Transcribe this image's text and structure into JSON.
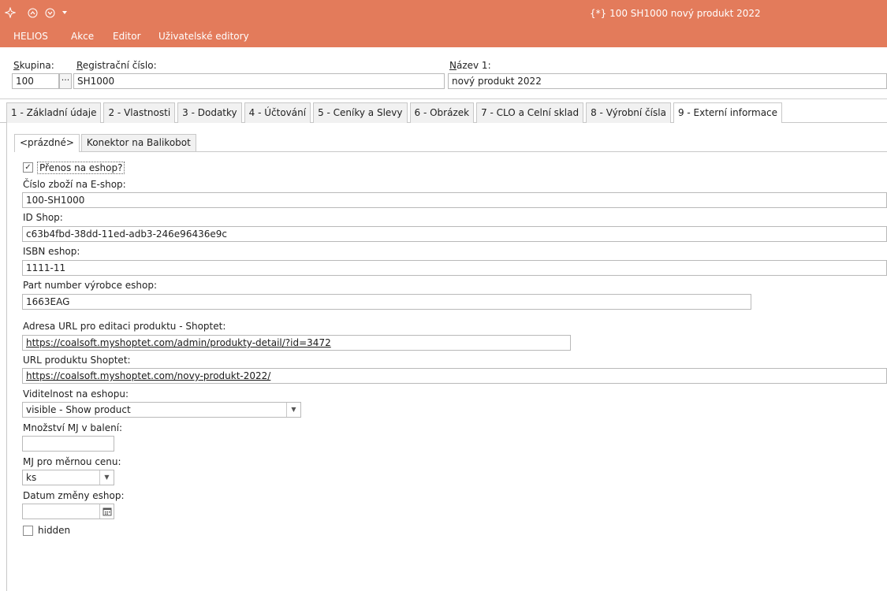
{
  "window": {
    "title": "{*} 100 SH1000 nový produkt 2022",
    "quick_icons": [
      "sparkle-icon",
      "up-circle-icon",
      "down-circle-icon",
      "dropdown-arrow-icon"
    ]
  },
  "menu": {
    "items": [
      "HELIOS",
      "Akce",
      "Editor",
      "Uživatelské editory"
    ]
  },
  "header": {
    "skupina_label": "Skupina:",
    "skupina_value": "100",
    "dots_label": "···",
    "reg_label": "Registrační číslo:",
    "reg_value": "SH1000",
    "nazev_label": "Název 1:",
    "nazev_value": "nový produkt 2022"
  },
  "tabs": [
    "1 - Základní údaje",
    "2 - Vlastnosti",
    "3 - Dodatky",
    "4 - Účtování",
    "5 - Ceníky a Slevy",
    "6 - Obrázek",
    "7 - CLO a Celní sklad",
    "8 - Výrobní čísla",
    "9 - Externí informace"
  ],
  "active_tab": "9 - Externí informace",
  "subtabs": [
    "<prázdné>",
    "Konektor na Balikobot"
  ],
  "form": {
    "prenos_label": "Přenos na eshop?",
    "prenos_checked": true,
    "cislo_label": "Číslo zboží na E-shop:",
    "cislo_value": "100-SH1000",
    "idshop_label": "ID Shop:",
    "idshop_value": "c63b4fbd-38dd-11ed-adb3-246e96436e9c",
    "isbn_label": "ISBN eshop:",
    "isbn_value": "1111-11",
    "part_label": "Part number výrobce eshop:",
    "part_value": "1663EAG",
    "adresa_label": "Adresa URL pro editaci produktu - Shoptet:",
    "adresa_value": "https://coalsoft.myshoptet.com/admin/produkty-detail/?id=3472",
    "url_label": "URL produktu Shoptet:",
    "url_value": "https://coalsoft.myshoptet.com/novy-produkt-2022/",
    "viditelnost_label": "Viditelnost na eshopu:",
    "viditelnost_value": "visible - Show product",
    "mnozstvi_label": "Množství MJ v balení:",
    "mnozstvi_value": "",
    "mj_label": "MJ pro měrnou cenu:",
    "mj_value": "ks",
    "datum_label": "Datum změny eshop:",
    "datum_value": "",
    "hidden_label": "hidden",
    "hidden_checked": false
  },
  "colors": {
    "accent": "#e37b5b"
  }
}
